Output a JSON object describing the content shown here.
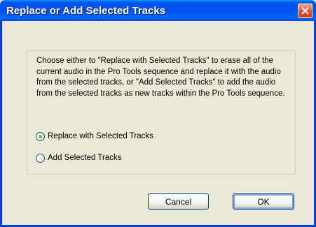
{
  "dialog": {
    "title": "Replace or Add Selected Tracks",
    "description": "Choose either to \"Replace with Selected Tracks\" to erase all of the current audio in the Pro Tools sequence and replace it with the audio from the selected tracks, or \"Add Selected Tracks\" to add the audio from the selected tracks as new tracks within the Pro Tools sequence.",
    "options": [
      {
        "label": "Replace with Selected Tracks",
        "selected": true
      },
      {
        "label": "Add Selected Tracks",
        "selected": false
      }
    ],
    "buttons": {
      "cancel": "Cancel",
      "ok": "OK"
    }
  },
  "icons": {
    "close": "close-icon",
    "radio": "radio-icon"
  },
  "colors": {
    "titlebar": "#0055EA",
    "close_button": "#E2502B",
    "dialog_background": "#ECE9D8",
    "radio_selected": "#1E9A1E"
  }
}
